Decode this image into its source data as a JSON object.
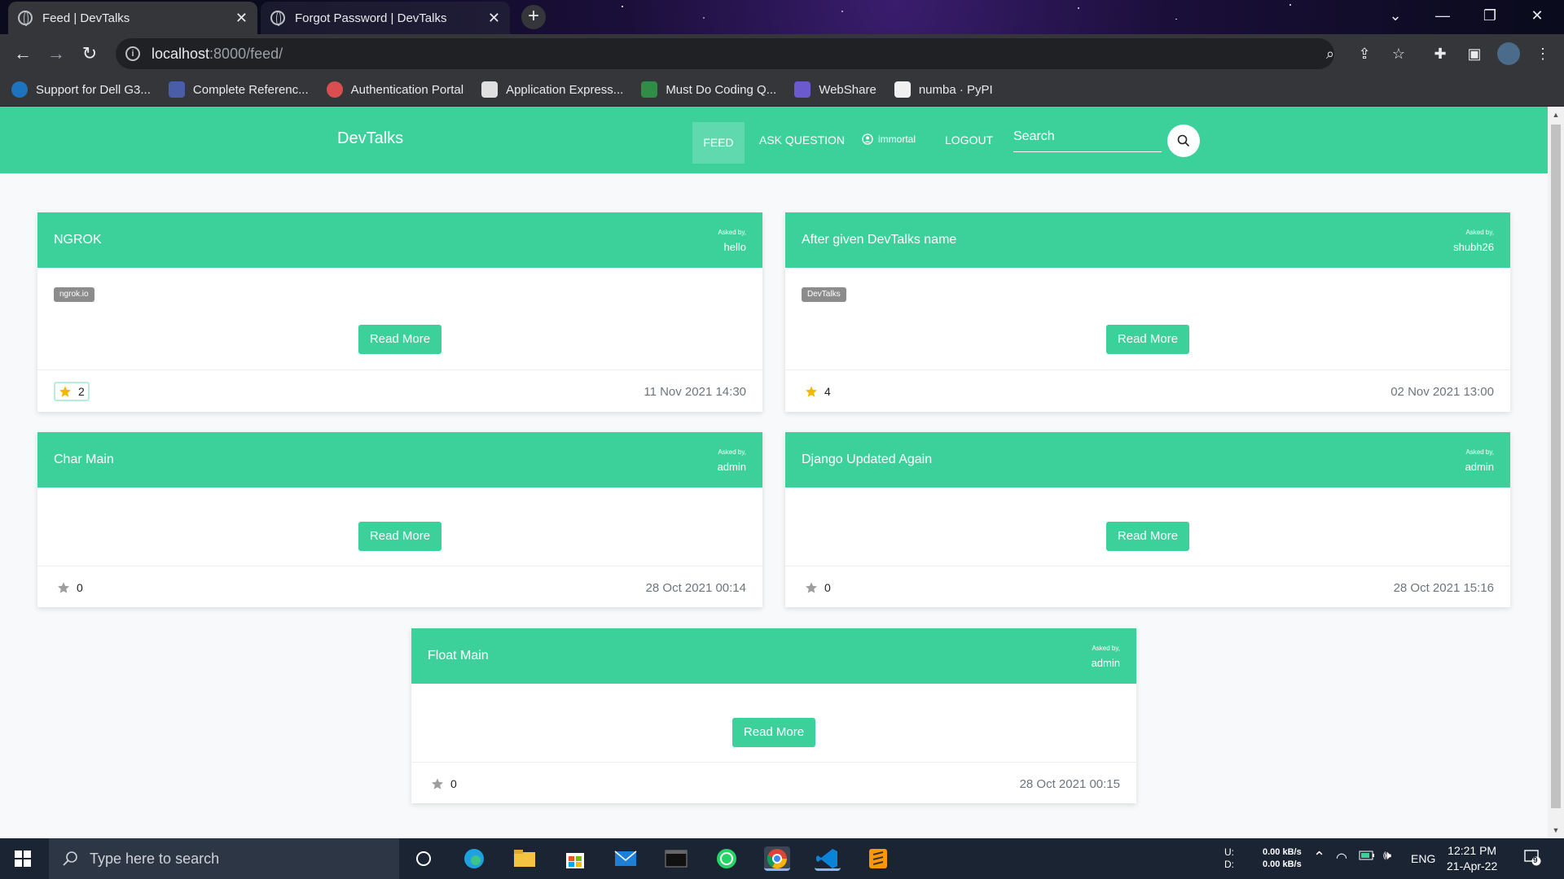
{
  "browser": {
    "tabs": [
      {
        "title": "Feed | DevTalks",
        "active": true
      },
      {
        "title": "Forgot Password | DevTalks",
        "active": false
      }
    ],
    "url_host": "localhost",
    "url_path": ":8000/feed/",
    "bookmarks": [
      {
        "label": "Support for Dell G3...",
        "color": "#1e73be"
      },
      {
        "label": "Complete Referenc...",
        "color": "#4a5da8"
      },
      {
        "label": "Authentication Portal",
        "color": "#d94f4f"
      },
      {
        "label": "Application Express...",
        "color": "#e0e0e0"
      },
      {
        "label": "Must Do Coding Q...",
        "color": "#2f8d46"
      },
      {
        "label": "WebShare",
        "color": "#6a5acd"
      },
      {
        "label": "numba · PyPI",
        "color": "#f0f0f0"
      }
    ]
  },
  "site": {
    "brand": "DevTalks",
    "nav": {
      "feed": "FEED",
      "ask": "ASK QUESTION",
      "user": "immortal",
      "logout": "LOGOUT"
    },
    "search_placeholder": "Search",
    "accent": "#3cd19b"
  },
  "posts": [
    {
      "title": "NGROK",
      "asked_by_label": "Asked by,",
      "asker": "hello",
      "tag": "ngrok.io",
      "read_more": "Read More",
      "stars": "2",
      "starred": true,
      "date": "11 Nov 2021 14:30"
    },
    {
      "title": "After given DevTalks name",
      "asked_by_label": "Asked by,",
      "asker": "shubh26",
      "tag": "DevTalks",
      "read_more": "Read More",
      "stars": "4",
      "starred": true,
      "date": "02 Nov 2021 13:00"
    },
    {
      "title": "Char Main",
      "asked_by_label": "Asked by,",
      "asker": "admin",
      "read_more": "Read More",
      "stars": "0",
      "starred": false,
      "date": "28 Oct 2021 00:14"
    },
    {
      "title": "Django Updated Again",
      "asked_by_label": "Asked by,",
      "asker": "admin",
      "read_more": "Read More",
      "stars": "0",
      "starred": false,
      "date": "28 Oct 2021 15:16"
    },
    {
      "title": "Float Main",
      "asked_by_label": "Asked by,",
      "asker": "admin",
      "read_more": "Read More",
      "stars": "0",
      "starred": false,
      "date": "28 Oct 2021 00:15"
    }
  ],
  "taskbar": {
    "search_placeholder": "Type here to search",
    "net_up_label": "U:",
    "net_down_label": "D:",
    "net_up": "0.00 kB/s",
    "net_down": "0.00 kB/s",
    "lang": "ENG",
    "time": "12:21 PM",
    "date": "21-Apr-22",
    "notifications": "9"
  }
}
